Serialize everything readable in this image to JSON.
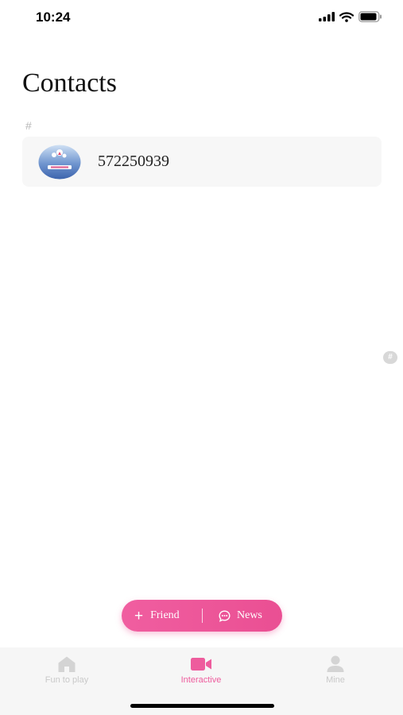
{
  "status_bar": {
    "time": "10:24"
  },
  "page": {
    "title": "Contacts"
  },
  "contacts": {
    "section_letter": "#",
    "items": [
      {
        "name": "572250939"
      }
    ],
    "index_letter": "#"
  },
  "actions": {
    "friend_label": "Friend",
    "news_label": "News"
  },
  "tab_bar": {
    "tabs": [
      {
        "label": "Fun to play",
        "icon": "home-icon"
      },
      {
        "label": "Interactive",
        "icon": "video-camera-icon",
        "active": true
      },
      {
        "label": "Mine",
        "icon": "person-icon"
      }
    ]
  },
  "colors": {
    "accent": "#ee5c9d",
    "tab_inactive": "#c9c9c9",
    "row_background": "#f7f7f7"
  }
}
